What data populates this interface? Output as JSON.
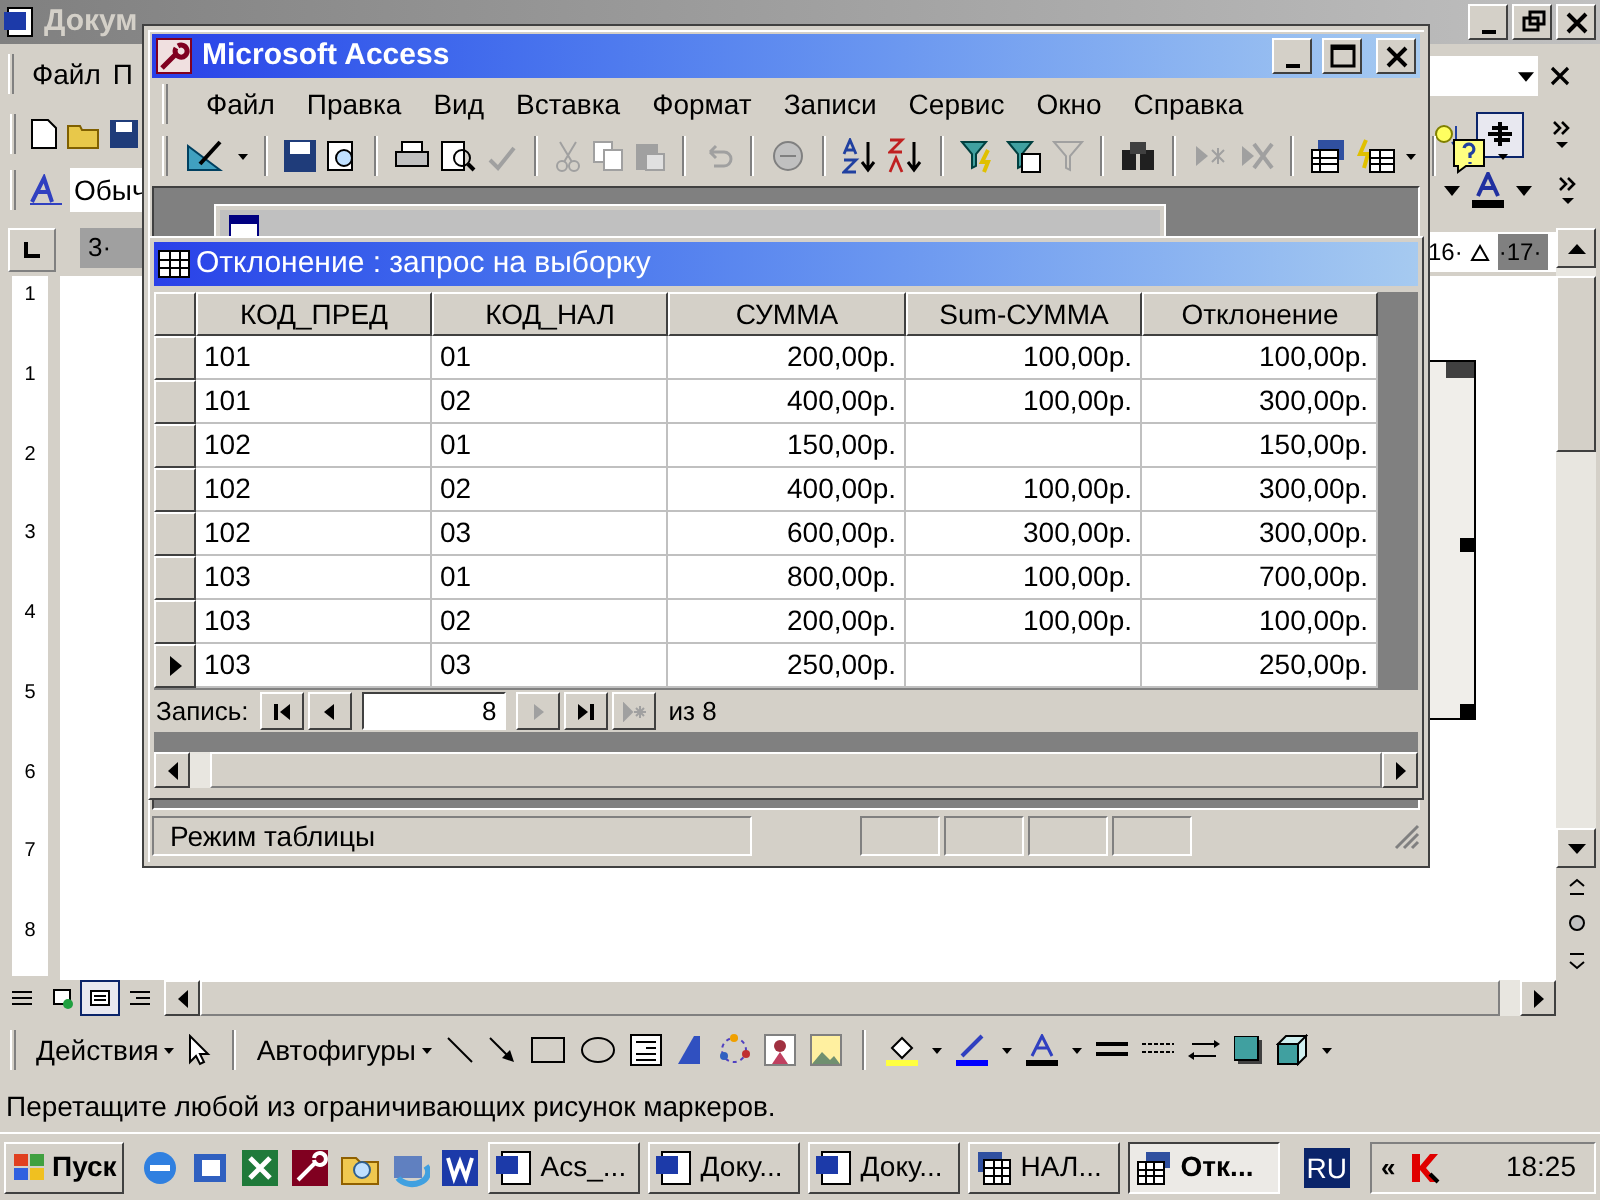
{
  "word": {
    "title": "Докум",
    "menu": [
      "Файл",
      "П"
    ],
    "style_field": "Обыч",
    "ruler_left": "3·",
    "ruler_right": [
      "16·",
      "·17·"
    ],
    "vertical_ruler": [
      "1",
      "1",
      "2",
      "3",
      "4",
      "5",
      "6",
      "7",
      "8"
    ],
    "drawing_toolbar": {
      "actions": "Действия",
      "autoshapes": "Автофигуры"
    },
    "status": "Перетащите любой из ограничивающих рисунок маркеров."
  },
  "access": {
    "title": "Microsoft Access",
    "menu": [
      "Файл",
      "Правка",
      "Вид",
      "Вставка",
      "Формат",
      "Записи",
      "Сервис",
      "Окно",
      "Справка"
    ],
    "query_window": {
      "title": "Отклонение : запрос на выборку",
      "columns": [
        "КОД_ПРЕД",
        "КОД_НАЛ",
        "СУММА",
        "Sum-СУММА",
        "Отклонение"
      ],
      "rows": [
        {
          "cells": [
            "101",
            "01",
            "200,00р.",
            "100,00р.",
            "100,00р."
          ],
          "current": false
        },
        {
          "cells": [
            "101",
            "02",
            "400,00р.",
            "100,00р.",
            "300,00р."
          ],
          "current": false
        },
        {
          "cells": [
            "102",
            "01",
            "150,00р.",
            null,
            "150,00р."
          ],
          "current": false
        },
        {
          "cells": [
            "102",
            "02",
            "400,00р.",
            "100,00р.",
            "300,00р."
          ],
          "current": false
        },
        {
          "cells": [
            "102",
            "03",
            "600,00р.",
            "300,00р.",
            "300,00р."
          ],
          "current": false
        },
        {
          "cells": [
            "103",
            "01",
            "800,00р.",
            "100,00р.",
            "700,00р."
          ],
          "current": false
        },
        {
          "cells": [
            "103",
            "02",
            "200,00р.",
            "100,00р.",
            "100,00р."
          ],
          "current": false
        },
        {
          "cells": [
            "103",
            "03",
            "250,00р.",
            null,
            "250,00р."
          ],
          "current": true
        }
      ],
      "navigator": {
        "label": "Запись:",
        "record": "8",
        "total": "из 8"
      }
    },
    "status": "Режим таблицы"
  },
  "taskbar": {
    "start": "Пуск",
    "tasks": [
      {
        "label": "Acs_...",
        "kind": "word",
        "selected": false
      },
      {
        "label": "Доку...",
        "kind": "word",
        "selected": false
      },
      {
        "label": "Доку...",
        "kind": "word",
        "selected": false
      },
      {
        "label": "НАЛ...",
        "kind": "database",
        "selected": false
      },
      {
        "label": "Отк...",
        "kind": "datasheet",
        "selected": true
      }
    ],
    "language": "RU",
    "tray_toggle": "«",
    "clock": "18:25"
  }
}
